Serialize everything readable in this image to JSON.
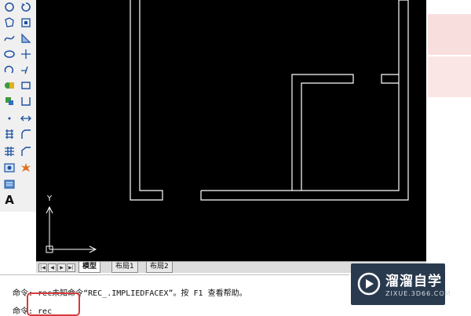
{
  "toolbar": {
    "items": [
      {
        "name": "line-icon"
      },
      {
        "name": "circle-icon"
      },
      {
        "name": "polygon-icon"
      },
      {
        "name": "rotate-icon"
      },
      {
        "name": "spline-icon"
      },
      {
        "name": "rectangle-icon"
      },
      {
        "name": "ellipse-icon"
      },
      {
        "name": "mirror-icon"
      },
      {
        "name": "arc-icon"
      },
      {
        "name": "offset-icon"
      },
      {
        "name": "insert-block-icon"
      },
      {
        "name": "trim-icon"
      },
      {
        "name": "make-block-icon"
      },
      {
        "name": "scale-icon"
      },
      {
        "name": "point-icon"
      },
      {
        "name": "stretch-icon"
      },
      {
        "name": "hatch-icon"
      },
      {
        "name": "fillet-icon"
      },
      {
        "name": "table-icon"
      },
      {
        "name": "chamfer-icon"
      },
      {
        "name": "region-icon"
      },
      {
        "name": "explode-icon"
      },
      {
        "name": "multiline-icon"
      },
      {
        "name": "text-icon",
        "glyph": "A"
      }
    ]
  },
  "axes": {
    "y_label": "Y"
  },
  "tabs": {
    "model": "模型",
    "layout1": "布局1",
    "layout2": "布局2"
  },
  "command": {
    "line1": "命令: rec未知命令“REC_.IMPLIEDFACEX”。按 F1 查看帮助。",
    "line2": "命令: rec"
  },
  "watermark": {
    "title": "溜溜自学",
    "url": "ZIXUE.3D66.COM"
  },
  "colors": {
    "viewport_bg": "#000000",
    "drawing_stroke": "#ffffff",
    "highlight": "#d83a3a",
    "watermark_bg": "#2a3a4e"
  }
}
